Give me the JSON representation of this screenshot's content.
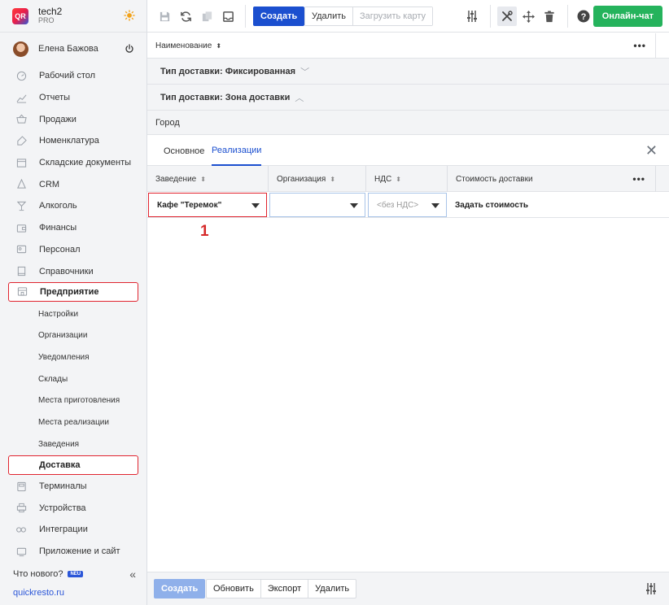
{
  "brand": {
    "name": "tech2",
    "sub": "PRO",
    "logo_text": "QR"
  },
  "user": {
    "name": "Елена Бажова"
  },
  "nav": [
    {
      "label": "Рабочий стол",
      "icon": "dashboard-icon"
    },
    {
      "label": "Отчеты",
      "icon": "chart-icon"
    },
    {
      "label": "Продажи",
      "icon": "basket-icon"
    },
    {
      "label": "Номенклатура",
      "icon": "tag-icon"
    },
    {
      "label": "Складские документы",
      "icon": "warehouse-icon"
    },
    {
      "label": "CRM",
      "icon": "people-icon"
    },
    {
      "label": "Алкоголь",
      "icon": "glass-icon"
    },
    {
      "label": "Финансы",
      "icon": "wallet-icon"
    },
    {
      "label": "Персонал",
      "icon": "id-card-icon"
    },
    {
      "label": "Справочники",
      "icon": "book-icon"
    }
  ],
  "nav_selected": {
    "label": "Предприятие",
    "icon": "enterprise-icon"
  },
  "sub_nav": [
    "Настройки",
    "Организации",
    "Уведомления",
    "Склады",
    "Места приготовления",
    "Места реализации",
    "Заведения"
  ],
  "sub_selected": "Доставка",
  "nav_bottom": [
    {
      "label": "Терминалы",
      "icon": "terminal-icon"
    },
    {
      "label": "Устройства",
      "icon": "printer-icon"
    },
    {
      "label": "Интеграции",
      "icon": "link-icon"
    },
    {
      "label": "Приложение и сайт",
      "icon": "phone-icon"
    }
  ],
  "whats_new": "Что нового?",
  "new_badge": "NEU",
  "site_link": "quickresto.ru",
  "toolbar": {
    "create": "Создать",
    "delete": "Удалить",
    "load_map": "Загрузить карту",
    "chat": "Онлайн-чат"
  },
  "list": {
    "name_header": "Наименование",
    "group_fixed": "Тип доставки: Фиксированная",
    "group_zone": "Тип доставки: Зона доставки",
    "city": "Город"
  },
  "tabs": {
    "main": "Основное",
    "sales": "Реализации"
  },
  "grid": {
    "columns": [
      "Заведение",
      "Организация",
      "НДС",
      "Стоимость доставки"
    ],
    "row": {
      "venue": "Кафе \"Теремок\"",
      "organization": "",
      "vat_placeholder": "<без НДС>",
      "set_cost": "Задать стоимость"
    }
  },
  "annotation_marker": "1",
  "bottom": {
    "create": "Создать",
    "refresh": "Обновить",
    "export": "Экспорт",
    "delete": "Удалить"
  },
  "colors": {
    "primary": "#1b4fcf",
    "chat": "#25b35c",
    "highlight": "#e0242f"
  }
}
